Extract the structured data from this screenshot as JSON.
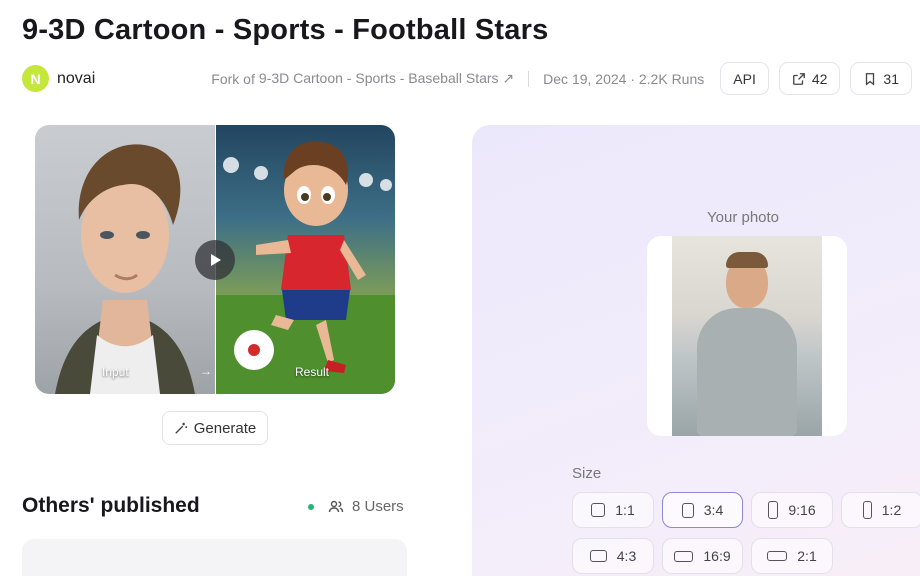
{
  "header": {
    "title": "9-3D Cartoon - Sports - Football Stars",
    "author_initial": "N",
    "author_name": "novai",
    "fork_prefix": "Fork of",
    "fork_link": "9-3D Cartoon - Sports - Baseball Stars ↗",
    "date_runs": "Dec 19, 2024 · 2.2K Runs",
    "api_label": "API",
    "share_count": "42",
    "bookmark_count": "31"
  },
  "preview": {
    "input_label": "Input",
    "result_label": "Result",
    "arrow": "→"
  },
  "generate_label": "Generate",
  "others": {
    "title": "Others' published",
    "users_label": "8 Users"
  },
  "panel": {
    "your_photo_label": "Your photo",
    "size_label": "Size",
    "size_options": [
      "1:1",
      "3:4",
      "9:16",
      "1:2",
      "4:3",
      "16:9",
      "2:1"
    ],
    "selected_size": "3:4"
  },
  "colors": {
    "avatar": "#c5e63a",
    "status_dot": "#22b573",
    "selected_border": "#8e86d6"
  }
}
